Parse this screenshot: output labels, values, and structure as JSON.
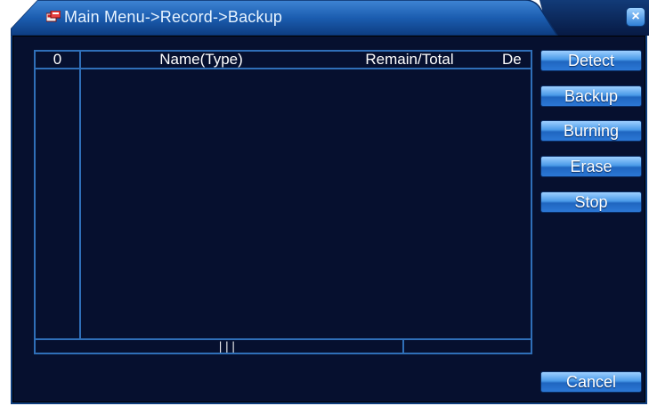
{
  "window": {
    "title": "Main Menu->Record->Backup",
    "close_glyph": "×"
  },
  "table": {
    "columns": [
      "0",
      "Name(Type)",
      "Remain/Total",
      "De"
    ],
    "rows": []
  },
  "scrollbar": {
    "grip_glyph": "|||"
  },
  "buttons": {
    "detect": "Detect",
    "backup": "Backup",
    "burning": "Burning",
    "erase": "Erase",
    "stop": "Stop",
    "cancel": "Cancel"
  },
  "icons": {
    "title": "backup-app-icon",
    "close": "close-icon"
  },
  "colors": {
    "title_bar": "#1b5db0",
    "panel_background": "#06102f",
    "grid_lines": "#2f6fb8",
    "button_gradient_top": "#9ed0ff",
    "button_gradient_bottom": "#1f66c0",
    "close_button": "#2f7fd6"
  }
}
